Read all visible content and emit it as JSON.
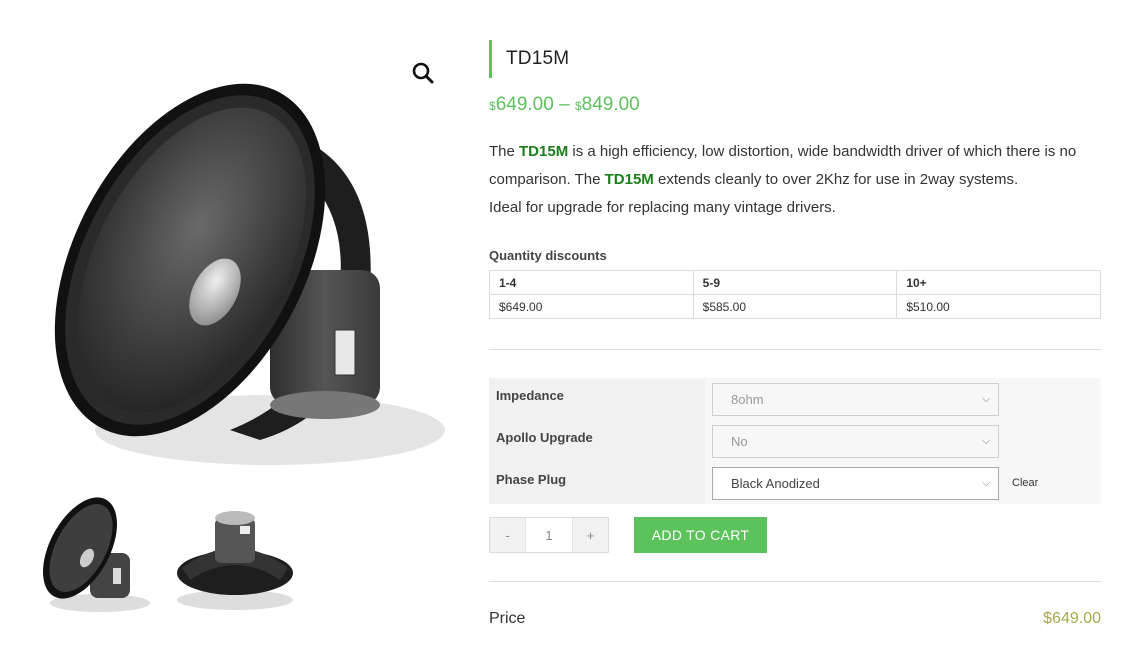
{
  "gallery": {
    "main_image": "speaker-driver-image",
    "zoom_icon": "magnifier-icon",
    "thumbnails": [
      "speaker-side-view",
      "speaker-back-view"
    ]
  },
  "product": {
    "title": "TD15M",
    "price_min_currency": "$",
    "price_min": "649.00",
    "price_sep": "–",
    "price_max_currency": "$",
    "price_max": "849.00",
    "desc_p1": "The ",
    "desc_bold1": "TD15M",
    "desc_p2": " is a high efficiency, low distortion, wide bandwidth driver of which there is no comparison. The ",
    "desc_bold2": "TD15M",
    "desc_p3": " extends cleanly to over 2Khz for use in 2way systems.",
    "desc_p4": " Ideal for upgrade for replacing many vintage drivers."
  },
  "discounts": {
    "title": "Quantity discounts",
    "headers": [
      "1-4",
      "5-9",
      "10+"
    ],
    "prices": [
      "$649.00",
      "$585.00",
      "$510.00"
    ]
  },
  "variations": {
    "impedance_label": "Impedance",
    "impedance_value": "8ohm",
    "apollo_label": "Apollo Upgrade",
    "apollo_value": "No",
    "phase_label": "Phase Plug",
    "phase_value": "Black Anodized",
    "clear_label": "Clear"
  },
  "cart": {
    "minus": "-",
    "quantity": "1",
    "plus": "+",
    "add_label": "ADD TO CART"
  },
  "price_line": {
    "label": "Price",
    "amount": "$649.00"
  },
  "colors": {
    "accent": "#5cc25c",
    "bold_green": "#1a7f1a",
    "price_olive": "#a8a84a"
  }
}
